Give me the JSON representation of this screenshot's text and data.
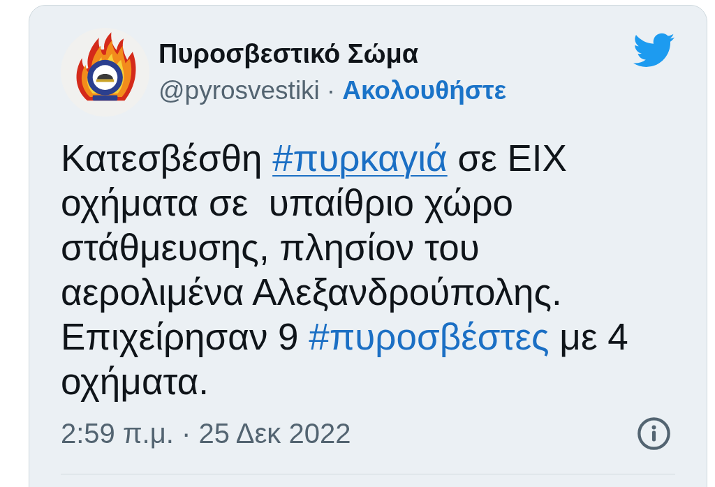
{
  "tweet": {
    "author": {
      "name": "Πυροσβεστικό Σώμα",
      "handle": "@pyrosvestiki",
      "separator": "·",
      "follow": "Ακολουθήστε"
    },
    "body": [
      {
        "kind": "text",
        "text": "Κατεσβέσθη "
      },
      {
        "kind": "hashtag",
        "text": "#πυρκαγιά",
        "underlined": true
      },
      {
        "kind": "text",
        "text": " σε ΕΙΧ οχήματα σε  υπαίθριο χώρο στάθμευσης, πλησίον του αερολιμένα Αλεξανδρούπολης. Επιχείρησαν 9 "
      },
      {
        "kind": "hashtag",
        "text": "#πυροσβέστες",
        "underlined": false
      },
      {
        "kind": "text",
        "text": " με 4 οχήματα."
      }
    ],
    "timestamp": "2:59 π.μ. · 25 Δεκ 2022"
  }
}
